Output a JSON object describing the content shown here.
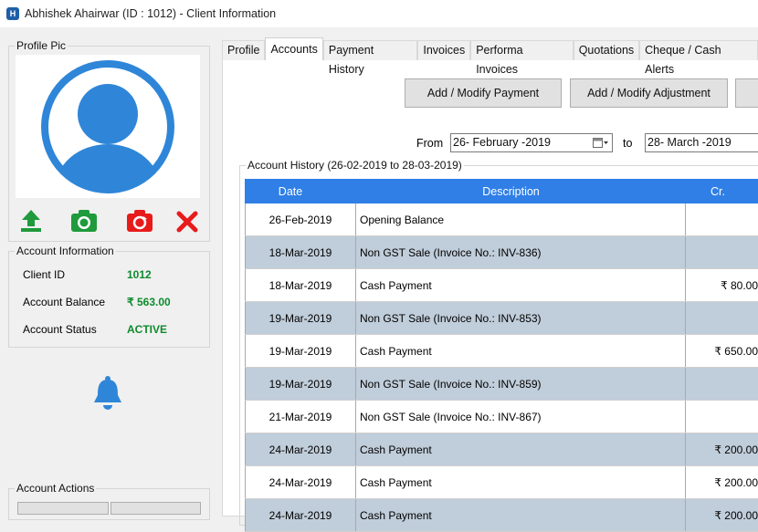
{
  "window": {
    "title": "Abhishek Ahairwar (ID : 1012) - Client Information",
    "app_icon": "H"
  },
  "profile_pic": {
    "label": "Profile Pic",
    "icons": [
      "upload-icon",
      "camera-icon",
      "refresh-icon",
      "delete-icon"
    ]
  },
  "account_info": {
    "label": "Account Information",
    "client_id_label": "Client ID",
    "client_id": "1012",
    "balance_label": "Account Balance",
    "balance": "₹ 563.00",
    "status_label": "Account Status",
    "status": "ACTIVE"
  },
  "notification": {
    "icon": "bell-icon"
  },
  "account_actions": {
    "label": "Account Actions"
  },
  "tabs": [
    {
      "label": "Profile"
    },
    {
      "label": "Accounts"
    },
    {
      "label": "Payment History"
    },
    {
      "label": "Invoices"
    },
    {
      "label": "Performa Invoices"
    },
    {
      "label": "Quotations"
    },
    {
      "label": "Cheque / Cash Alerts"
    }
  ],
  "buttons": {
    "add_payment": "Add / Modify Payment",
    "add_adjustment": "Add / Modify Adjustment"
  },
  "filter": {
    "from_label": "From",
    "from_value": "26-  February  -2019",
    "to_label": "to",
    "to_value": "28-   March    -2019"
  },
  "history": {
    "label": "Account History (26-02-2019 to 28-03-2019)",
    "columns": [
      "Date",
      "Description",
      "Cr."
    ],
    "rows": [
      {
        "date": "26-Feb-2019",
        "desc": "Opening Balance",
        "cr": ""
      },
      {
        "date": "18-Mar-2019",
        "desc": "Non GST Sale (Invoice No.: INV-836)",
        "cr": ""
      },
      {
        "date": "18-Mar-2019",
        "desc": "Cash Payment",
        "cr": "₹ 80.00"
      },
      {
        "date": "19-Mar-2019",
        "desc": "Non GST Sale (Invoice No.: INV-853)",
        "cr": ""
      },
      {
        "date": "19-Mar-2019",
        "desc": "Cash Payment",
        "cr": "₹ 650.00"
      },
      {
        "date": "19-Mar-2019",
        "desc": "Non GST Sale (Invoice No.: INV-859)",
        "cr": ""
      },
      {
        "date": "21-Mar-2019",
        "desc": "Non GST Sale (Invoice No.: INV-867)",
        "cr": ""
      },
      {
        "date": "24-Mar-2019",
        "desc": "Cash Payment",
        "cr": "₹ 200.00"
      },
      {
        "date": "24-Mar-2019",
        "desc": "Cash Payment",
        "cr": "₹ 200.00"
      },
      {
        "date": "24-Mar-2019",
        "desc": "Cash Payment",
        "cr": "₹ 200.00"
      }
    ]
  },
  "colors": {
    "header_blue": "#2f7fe6",
    "alt_row": "#c0cdda",
    "green": "#0f8a2d",
    "red": "#e81b1b"
  }
}
